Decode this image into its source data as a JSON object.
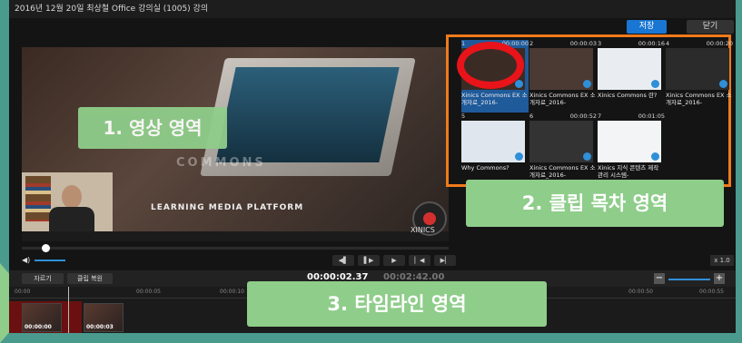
{
  "window": {
    "title": "2016년 12월 20일 최상철 Office 강의실 (1005) 강의"
  },
  "top_buttons": {
    "save": "저장",
    "close": "닫기"
  },
  "video": {
    "brand": "COMMONS",
    "tagline": "LEARNING MEDIA PLATFORM",
    "logo": "XINICS"
  },
  "clips": [
    {
      "num": "1",
      "time": "00:00:00",
      "title": "Xinics Commons EX 소개자료_2016-"
    },
    {
      "num": "2",
      "time": "00:00:03",
      "title": "Xinics Commons EX 소개자료_2016-"
    },
    {
      "num": "3",
      "time": "00:00:16",
      "title": "Xinics Commons 란?"
    },
    {
      "num": "4",
      "time": "00:00:20",
      "title": "Xinics Commons EX 소개자료_2016-"
    },
    {
      "num": "5",
      "time": "",
      "title": "Why Commons?"
    },
    {
      "num": "6",
      "time": "00:00:52",
      "title": "Xinics Commons EX 소개자료_2016-"
    },
    {
      "num": "7",
      "time": "00:01:05",
      "title": "Xinics 지식 콘텐츠 제작 관리 시스템-"
    }
  ],
  "controls": {
    "speed": "x 1.0"
  },
  "toolbar": {
    "cut": "자르기",
    "restore": "클립 복원",
    "current_time": "00:00:02.37",
    "total_time": "00:02:42.00"
  },
  "timeline": {
    "ticks": [
      "00:00",
      "00:00:05",
      "00:00:10",
      "00:00:50",
      "00:00:55"
    ],
    "clip_times": [
      "00:00:00",
      "00:00:03"
    ]
  },
  "annotations": {
    "video_area": "1. 영상 영역",
    "clip_area": "2. 클립 목차 영역",
    "timeline_area": "3. 타임라인 영역"
  },
  "colors": {
    "accent": "#1976d2",
    "highlight": "#f07a1a",
    "label_bg": "#8fcd8a",
    "marker": "#e8141a"
  }
}
